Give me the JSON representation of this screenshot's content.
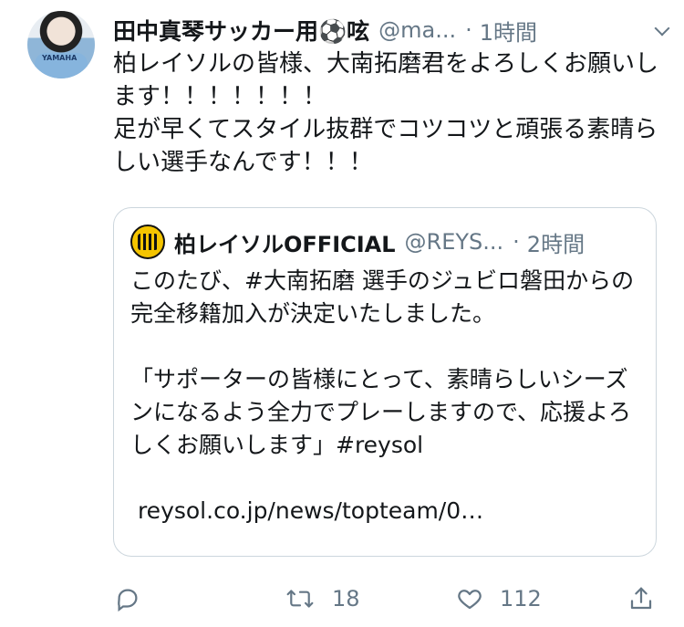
{
  "tweet": {
    "display_name": "田中真琴サッカー用⚽呟",
    "handle": "@ma...",
    "separator": "·",
    "time": "1時間",
    "text": "柏レイソルの皆様、大南拓磨君をよろしくお願いします！！！！！！！\n足が早くてスタイル抜群でコツコツと頑張る素晴らしい選手なんです！！！",
    "avatar_shirt_text": "YAMAHA"
  },
  "quoted_tweet": {
    "display_name": "柏レイソルOFFICIAL",
    "handle": "@REYS...",
    "separator": "·",
    "time": "2時間",
    "text": "このたび、#大南拓磨 選手のジュビロ磐田からの完全移籍加入が決定いたしました。\n\n「サポーターの皆様にとって、素晴らしいシーズンになるよう全力でプレーしますので、応援よろしくお願いします」#reysol\n\n reysol.co.jp/news/topteam/0…"
  },
  "actions": {
    "reply_icon": "reply-icon",
    "retweet_icon": "retweet-icon",
    "retweet_count": "18",
    "like_icon": "heart-icon",
    "like_count": "112",
    "share_icon": "share-icon"
  },
  "colors": {
    "text": "#14171a",
    "secondary": "#657786",
    "border": "#ccd6dd",
    "background": "#ffffff"
  }
}
